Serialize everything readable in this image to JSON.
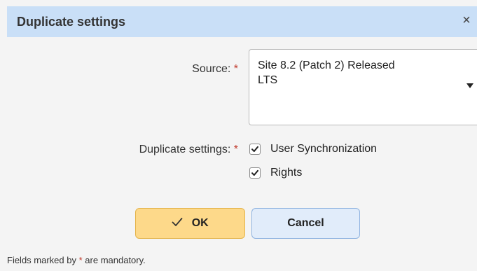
{
  "dialog": {
    "title": "Duplicate settings",
    "close_glyph": "×"
  },
  "form": {
    "source": {
      "label": "Source:",
      "required_mark": "*",
      "value_line1": "Site 8.2 (Patch 2) Released",
      "value_line2": "LTS"
    },
    "duplicate": {
      "label": "Duplicate settings:",
      "required_mark": "*",
      "options": [
        {
          "label": "User Synchronization",
          "checked": true
        },
        {
          "label": "Rights",
          "checked": true
        }
      ]
    }
  },
  "buttons": {
    "ok_label": "OK",
    "cancel_label": "Cancel"
  },
  "footer": {
    "prefix": "Fields marked by",
    "required_mark": "*",
    "suffix": "are mandatory."
  },
  "colors": {
    "titlebar": "#c9dff7",
    "ok_button": "#fdd98a",
    "cancel_button": "#e1ecfa",
    "required": "#c0392b"
  }
}
